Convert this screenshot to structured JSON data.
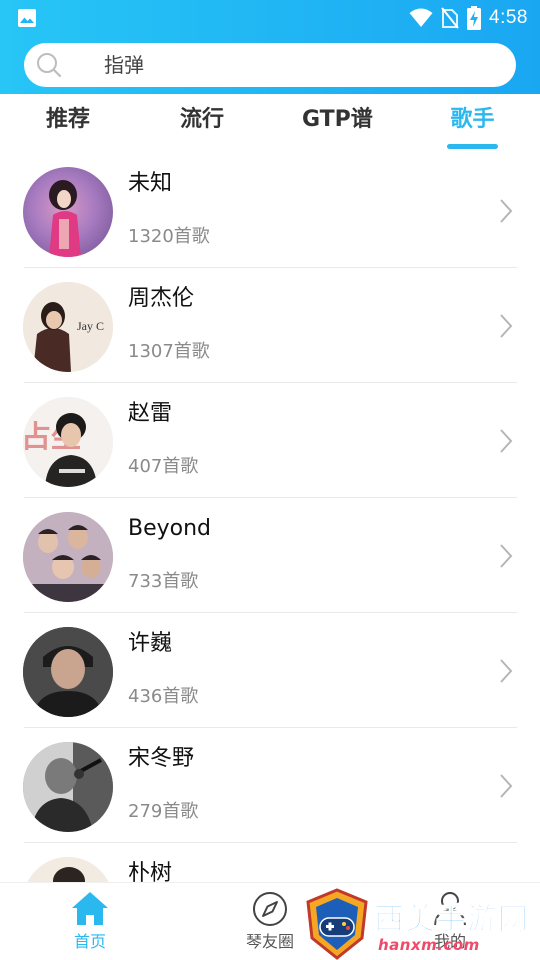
{
  "status_bar": {
    "time": "4:58",
    "icons": [
      "gallery-icon",
      "wifi-icon",
      "no-sim-icon",
      "battery-charging-icon"
    ]
  },
  "search": {
    "placeholder": "指弹",
    "icon": "search-icon"
  },
  "tabs": [
    {
      "label": "推荐",
      "active": false
    },
    {
      "label": "流行",
      "active": false
    },
    {
      "label": "GTP谱",
      "active": false
    },
    {
      "label": "歌手",
      "active": true
    }
  ],
  "artists": [
    {
      "name": "未知",
      "count": "1320首歌"
    },
    {
      "name": "周杰伦",
      "count": "1307首歌"
    },
    {
      "name": "赵雷",
      "count": "407首歌"
    },
    {
      "name": "Beyond",
      "count": "733首歌"
    },
    {
      "name": "许巍",
      "count": "436首歌"
    },
    {
      "name": "宋冬野",
      "count": "279首歌"
    },
    {
      "name": "朴树",
      "count": ""
    }
  ],
  "bottom_nav": [
    {
      "label": "首页",
      "icon": "home-icon",
      "active": true
    },
    {
      "label": "琴友圈",
      "icon": "compass-icon",
      "active": false
    },
    {
      "label": "我的",
      "icon": "user-icon",
      "active": false
    }
  ],
  "watermark": {
    "text": "西美手游网",
    "url": "hanxm.com"
  },
  "colors": {
    "header_start": "#27c6f6",
    "header_end": "#1aa7f2",
    "accent": "#2bb8ef",
    "secondary_text": "#8a8a8a"
  }
}
